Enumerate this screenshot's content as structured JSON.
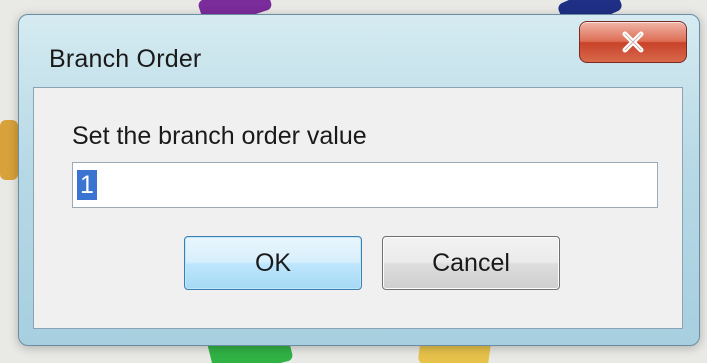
{
  "dialog": {
    "title": "Branch Order",
    "close_icon": "close-icon",
    "prompt": "Set the branch order value",
    "input_value": "1",
    "ok_label": "OK",
    "cancel_label": "Cancel"
  },
  "colors": {
    "close_button": "#d8563c",
    "selection": "#3a74d0",
    "ok_border": "#3c7fb1"
  }
}
